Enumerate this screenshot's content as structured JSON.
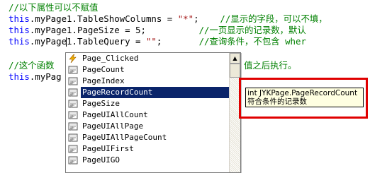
{
  "code": {
    "comment_1": "//以下属性可以不赋值",
    "line_2": {
      "this": "this",
      "member": ".myPage1.TableShowColumns = ",
      "value": "\"*\"",
      "end": ";    ",
      "comment": "//显示的字段，可以不填，"
    },
    "line_3": {
      "this": "this",
      "member": ".myPage1.PageSize = 5;          ",
      "comment": "//一页显示的记录数，默认"
    },
    "line_4": {
      "this": "this",
      "member": ".myPage1.TableQuery = ",
      "value": "\"\"",
      "end": ";       ",
      "comment": "//查询条件，不包含 wher"
    },
    "line_5": {
      "comment_start": "//这个函数",
      "comment_end": "值之后执行。"
    },
    "line_6": {
      "this": "this",
      "member": ".myPag"
    }
  },
  "completion": {
    "items": [
      {
        "label": "Page_Clicked",
        "icon": "event-icon"
      },
      {
        "label": "PageCount",
        "icon": "property-icon"
      },
      {
        "label": "PageIndex",
        "icon": "property-icon"
      },
      {
        "label": "PageRecordCount",
        "icon": "property-icon",
        "selected": true
      },
      {
        "label": "PageSize",
        "icon": "property-icon"
      },
      {
        "label": "PageUIAllCount",
        "icon": "property-icon"
      },
      {
        "label": "PageUIAllPage",
        "icon": "property-icon"
      },
      {
        "label": "PageUIAllPageCount",
        "icon": "property-icon"
      },
      {
        "label": "PageUIFirst",
        "icon": "property-icon"
      },
      {
        "label": "PageUIGO",
        "icon": "property-icon"
      }
    ],
    "scroll_up": "▲"
  },
  "tooltip": {
    "signature": "int JYKPage.PageRecordCount",
    "description": "符合条件的记录数"
  },
  "colors": {
    "comment": "#008000",
    "keyword": "#0000ff",
    "string": "#a31515",
    "selection": "#0a246a",
    "tooltip_bg": "#ffffe1",
    "highlight": "#e00000"
  }
}
